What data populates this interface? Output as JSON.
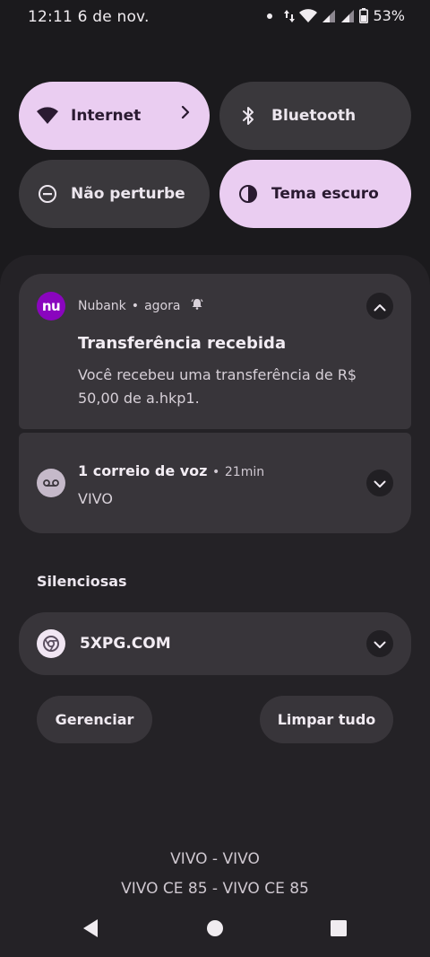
{
  "status_bar": {
    "time": "12:11",
    "date": "6 de nov.",
    "battery": "53%",
    "icons": [
      "notification-dot-icon",
      "data-arrows-icon",
      "wifi-icon",
      "signal-icon",
      "signal-icon",
      "battery-icon"
    ]
  },
  "quick_settings": [
    {
      "label": "Internet",
      "active": true,
      "icon": "wifi-icon"
    },
    {
      "label": "Bluetooth",
      "active": false,
      "icon": "bluetooth-icon"
    },
    {
      "label": "Não perturbe",
      "active": false,
      "icon": "do-not-disturb-icon"
    },
    {
      "label": "Tema escuro",
      "active": true,
      "icon": "dark-theme-icon"
    }
  ],
  "notifications": [
    {
      "app": "Nubank",
      "time": "agora",
      "icon_text": "nu",
      "title": "Transferência recebida",
      "body": "Você recebeu uma transferência de R$ 50,00 de a.hkp1.",
      "expanded": true
    },
    {
      "title": "1 correio de voz",
      "time": "21min",
      "sub": "VIVO",
      "icon": "voicemail-icon",
      "expanded": false
    }
  ],
  "silent_section": {
    "title": "Silenciosas",
    "items": [
      {
        "title": "5XPG.COM",
        "icon": "chrome-icon",
        "expanded": false
      }
    ]
  },
  "actions": {
    "manage": "Gerenciar",
    "clear_all": "Limpar tudo"
  },
  "carrier": {
    "line1": "VIVO - VIVO",
    "line2": "VIVO CE 85 - VIVO CE 85"
  },
  "separator": "•",
  "colors": {
    "accent_tile": "#eacdf1",
    "nubank": "#8a05be",
    "shade_bg": "#242226",
    "card_bg": "#38353a"
  }
}
